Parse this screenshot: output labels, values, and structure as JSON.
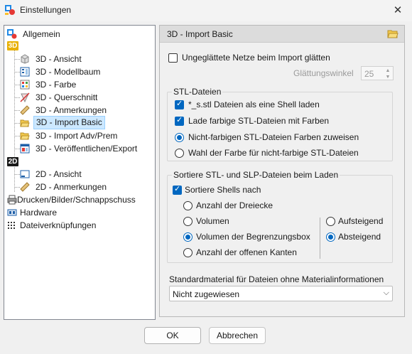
{
  "window": {
    "title": "Einstellungen",
    "close_glyph": "✕"
  },
  "tree": {
    "items": [
      {
        "label": "Allgemein",
        "icon": "general-settings-icon"
      },
      {
        "label": "3D - Ansicht",
        "icon": "cube-icon"
      },
      {
        "label": "3D - Modellbaum",
        "icon": "model-tree-icon"
      },
      {
        "label": "3D - Farbe",
        "icon": "palette-icon"
      },
      {
        "label": "3D - Querschnitt",
        "icon": "cross-section-icon"
      },
      {
        "label": "3D - Anmerkungen",
        "icon": "ruler-icon"
      },
      {
        "label": "3D - Import Basic",
        "icon": "folder-open-icon",
        "selected": true
      },
      {
        "label": "3D - Import Adv/Prem",
        "icon": "folder-open-icon"
      },
      {
        "label": "3D - Veröffentlichen/Export",
        "icon": "publish-icon"
      },
      {
        "label": "2D - Ansicht",
        "icon": "sheet-icon"
      },
      {
        "label": "2D - Anmerkungen",
        "icon": "ruler-icon"
      },
      {
        "label": "Drucken/Bilder/Schnappschuss",
        "icon": "printer-icon"
      },
      {
        "label": "Hardware",
        "icon": "hardware-icon"
      },
      {
        "label": "Dateiverknüpfungen",
        "icon": "file-association-icon"
      }
    ],
    "tag_3d": "3D",
    "tag_2d": "2D"
  },
  "panel": {
    "title": "3D - Import Basic",
    "smooth_meshes_label": "Ungeglättete Netze beim Import glätten",
    "smooth_meshes_checked": false,
    "smoothing_angle_label": "Glättungswinkel",
    "smoothing_angle_value": "25",
    "stl_group": {
      "title": "STL-Dateien",
      "single_shell_label": "*_s.stl Dateien als eine Shell laden",
      "single_shell_checked": true,
      "load_colored_label": "Lade farbige STL-Dateien mit Farben",
      "load_colored_checked": true,
      "assign_colors_label": "Nicht-farbigen STL-Dateien Farben zuweisen",
      "choose_color_label": "Wahl der Farbe für nicht-farbige STL-Dateien",
      "selected_option": "assign_colors"
    },
    "sort_group": {
      "title": "Sortiere STL- und SLP-Dateien beim Laden",
      "sort_shells_label": "Sortiere Shells nach",
      "sort_shells_checked": true,
      "criteria": [
        "Anzahl der Dreiecke",
        "Volumen",
        "Volumen der Begrenzungsbox",
        "Anzahl der offenen Kanten"
      ],
      "selected_criterion": "Volumen der Begrenzungsbox",
      "order": [
        "Aufsteigend",
        "Absteigend"
      ],
      "selected_order": "Absteigend"
    },
    "material_label": "Standardmaterial für Dateien ohne Materialinformationen",
    "material_value": "Nicht zugewiesen"
  },
  "buttons": {
    "ok": "OK",
    "cancel": "Abbrechen"
  },
  "colors": {
    "accent": "#0067c0",
    "selection": "#cce8ff",
    "tag_3d": "#e8b000"
  }
}
